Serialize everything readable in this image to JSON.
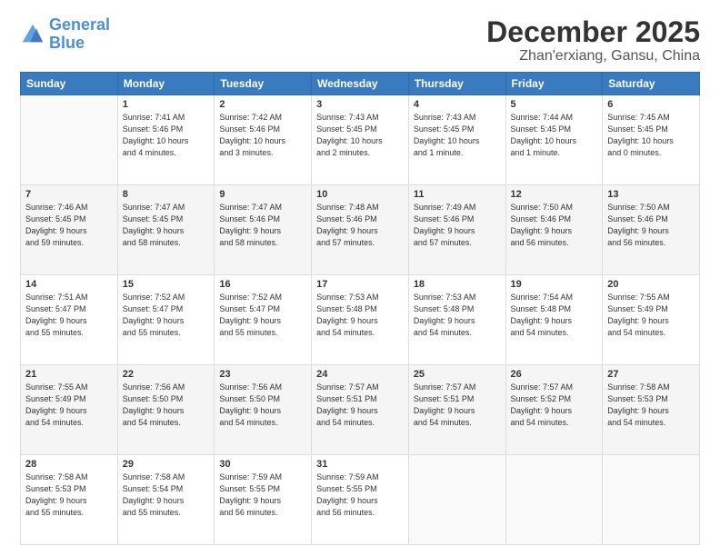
{
  "logo": {
    "line1": "General",
    "line2": "Blue"
  },
  "title": "December 2025",
  "subtitle": "Zhan'erxiang, Gansu, China",
  "days_header": [
    "Sunday",
    "Monday",
    "Tuesday",
    "Wednesday",
    "Thursday",
    "Friday",
    "Saturday"
  ],
  "weeks": [
    [
      {
        "num": "",
        "info": ""
      },
      {
        "num": "1",
        "info": "Sunrise: 7:41 AM\nSunset: 5:46 PM\nDaylight: 10 hours\nand 4 minutes."
      },
      {
        "num": "2",
        "info": "Sunrise: 7:42 AM\nSunset: 5:46 PM\nDaylight: 10 hours\nand 3 minutes."
      },
      {
        "num": "3",
        "info": "Sunrise: 7:43 AM\nSunset: 5:45 PM\nDaylight: 10 hours\nand 2 minutes."
      },
      {
        "num": "4",
        "info": "Sunrise: 7:43 AM\nSunset: 5:45 PM\nDaylight: 10 hours\nand 1 minute."
      },
      {
        "num": "5",
        "info": "Sunrise: 7:44 AM\nSunset: 5:45 PM\nDaylight: 10 hours\nand 1 minute."
      },
      {
        "num": "6",
        "info": "Sunrise: 7:45 AM\nSunset: 5:45 PM\nDaylight: 10 hours\nand 0 minutes."
      }
    ],
    [
      {
        "num": "7",
        "info": "Sunrise: 7:46 AM\nSunset: 5:45 PM\nDaylight: 9 hours\nand 59 minutes."
      },
      {
        "num": "8",
        "info": "Sunrise: 7:47 AM\nSunset: 5:45 PM\nDaylight: 9 hours\nand 58 minutes."
      },
      {
        "num": "9",
        "info": "Sunrise: 7:47 AM\nSunset: 5:46 PM\nDaylight: 9 hours\nand 58 minutes."
      },
      {
        "num": "10",
        "info": "Sunrise: 7:48 AM\nSunset: 5:46 PM\nDaylight: 9 hours\nand 57 minutes."
      },
      {
        "num": "11",
        "info": "Sunrise: 7:49 AM\nSunset: 5:46 PM\nDaylight: 9 hours\nand 57 minutes."
      },
      {
        "num": "12",
        "info": "Sunrise: 7:50 AM\nSunset: 5:46 PM\nDaylight: 9 hours\nand 56 minutes."
      },
      {
        "num": "13",
        "info": "Sunrise: 7:50 AM\nSunset: 5:46 PM\nDaylight: 9 hours\nand 56 minutes."
      }
    ],
    [
      {
        "num": "14",
        "info": "Sunrise: 7:51 AM\nSunset: 5:47 PM\nDaylight: 9 hours\nand 55 minutes."
      },
      {
        "num": "15",
        "info": "Sunrise: 7:52 AM\nSunset: 5:47 PM\nDaylight: 9 hours\nand 55 minutes."
      },
      {
        "num": "16",
        "info": "Sunrise: 7:52 AM\nSunset: 5:47 PM\nDaylight: 9 hours\nand 55 minutes."
      },
      {
        "num": "17",
        "info": "Sunrise: 7:53 AM\nSunset: 5:48 PM\nDaylight: 9 hours\nand 54 minutes."
      },
      {
        "num": "18",
        "info": "Sunrise: 7:53 AM\nSunset: 5:48 PM\nDaylight: 9 hours\nand 54 minutes."
      },
      {
        "num": "19",
        "info": "Sunrise: 7:54 AM\nSunset: 5:48 PM\nDaylight: 9 hours\nand 54 minutes."
      },
      {
        "num": "20",
        "info": "Sunrise: 7:55 AM\nSunset: 5:49 PM\nDaylight: 9 hours\nand 54 minutes."
      }
    ],
    [
      {
        "num": "21",
        "info": "Sunrise: 7:55 AM\nSunset: 5:49 PM\nDaylight: 9 hours\nand 54 minutes."
      },
      {
        "num": "22",
        "info": "Sunrise: 7:56 AM\nSunset: 5:50 PM\nDaylight: 9 hours\nand 54 minutes."
      },
      {
        "num": "23",
        "info": "Sunrise: 7:56 AM\nSunset: 5:50 PM\nDaylight: 9 hours\nand 54 minutes."
      },
      {
        "num": "24",
        "info": "Sunrise: 7:57 AM\nSunset: 5:51 PM\nDaylight: 9 hours\nand 54 minutes."
      },
      {
        "num": "25",
        "info": "Sunrise: 7:57 AM\nSunset: 5:51 PM\nDaylight: 9 hours\nand 54 minutes."
      },
      {
        "num": "26",
        "info": "Sunrise: 7:57 AM\nSunset: 5:52 PM\nDaylight: 9 hours\nand 54 minutes."
      },
      {
        "num": "27",
        "info": "Sunrise: 7:58 AM\nSunset: 5:53 PM\nDaylight: 9 hours\nand 54 minutes."
      }
    ],
    [
      {
        "num": "28",
        "info": "Sunrise: 7:58 AM\nSunset: 5:53 PM\nDaylight: 9 hours\nand 55 minutes."
      },
      {
        "num": "29",
        "info": "Sunrise: 7:58 AM\nSunset: 5:54 PM\nDaylight: 9 hours\nand 55 minutes."
      },
      {
        "num": "30",
        "info": "Sunrise: 7:59 AM\nSunset: 5:55 PM\nDaylight: 9 hours\nand 56 minutes."
      },
      {
        "num": "31",
        "info": "Sunrise: 7:59 AM\nSunset: 5:55 PM\nDaylight: 9 hours\nand 56 minutes."
      },
      {
        "num": "",
        "info": ""
      },
      {
        "num": "",
        "info": ""
      },
      {
        "num": "",
        "info": ""
      }
    ]
  ]
}
